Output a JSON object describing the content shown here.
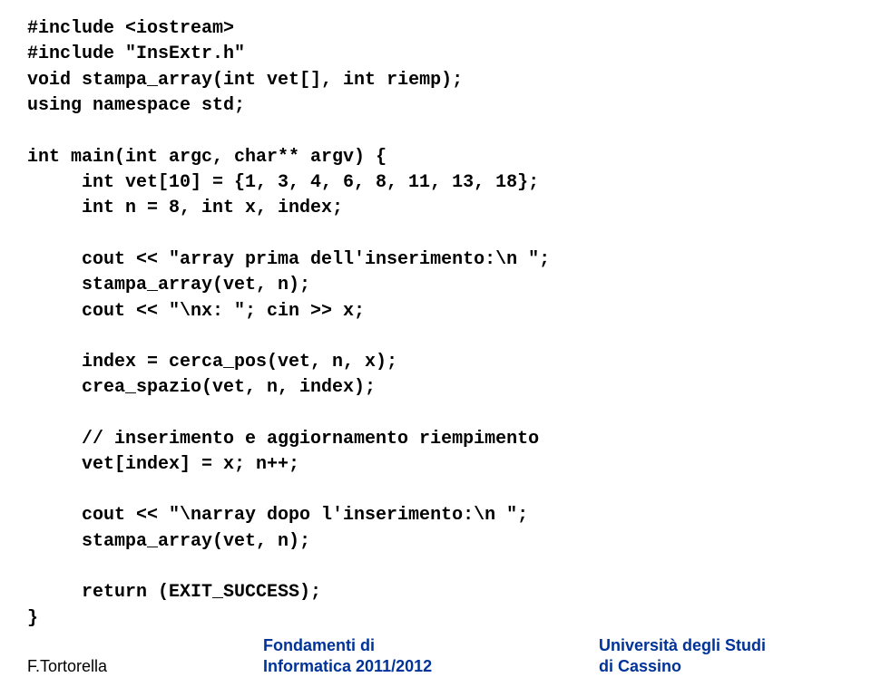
{
  "code": {
    "l1": "#include <iostream>",
    "l2": "#include \"InsExtr.h\"",
    "l3": "void stampa_array(int vet[], int riemp);",
    "l4": "using namespace std;",
    "l5": "int main(int argc, char** argv) {",
    "l6": "int vet[10] = {1, 3, 4, 6, 8, 11, 13, 18};",
    "l7": "int n = 8, int x, index;",
    "l8": "cout << \"array prima dell'inserimento:\\n \";",
    "l9": "stampa_array(vet, n);",
    "l10": "cout << \"\\nx: \"; cin >> x;",
    "l11": "index = cerca_pos(vet, n, x);",
    "l12": "crea_spazio(vet, n, index);",
    "l13": "// inserimento e aggiornamento riempimento",
    "l14": "vet[index] = x; n++;",
    "l15": "cout << \"\\narray dopo l'inserimento:\\n \";",
    "l16": "stampa_array(vet, n);",
    "l17": "return (EXIT_SUCCESS);",
    "l18": "}"
  },
  "footer": {
    "author": "F.Tortorella",
    "center_l1": "Fondamenti di",
    "center_l2": "Informatica 2011/2012",
    "right_l1": "Università degli Studi",
    "right_l2": "di Cassino"
  }
}
